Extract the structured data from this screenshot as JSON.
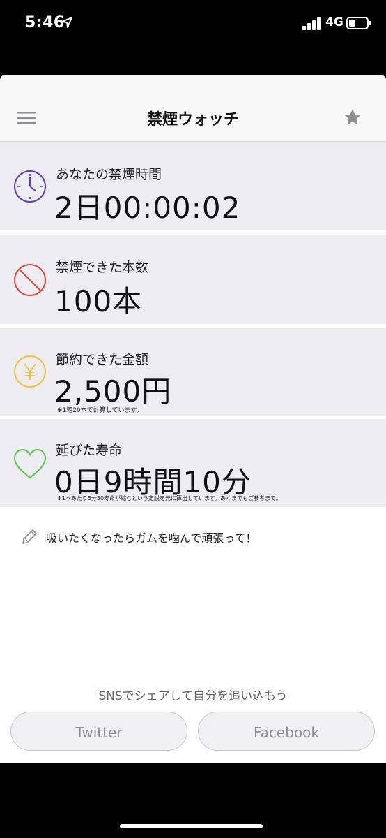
{
  "status_bar": {
    "time": "5:46",
    "network": "4G",
    "icons": [
      "location-arrow-icon",
      "signal-bars-icon",
      "battery-icon"
    ]
  },
  "nav": {
    "title": "禁煙ウォッチ",
    "left_icon": "hamburger-menu-icon",
    "right_icon": "star-icon"
  },
  "stats": [
    {
      "icon": "clock-icon",
      "label": "あなたの禁煙時間",
      "value": "2日00:00:02",
      "color": "#5b3bc4"
    },
    {
      "icon": "prohibited-icon",
      "label": "禁煙できた本数",
      "value": "100本",
      "color": "#e0453a"
    },
    {
      "icon": "yen-icon",
      "label": "節約できた金額",
      "value": "2,500円",
      "note": "※1箱20本で計算しています。",
      "color": "#f2c23a"
    },
    {
      "icon": "heart-icon",
      "label": "延びた寿命",
      "value": "0日9時間10分",
      "note": "※1本あたり5分30寿命が縮むという定説を元に算出しています。あくまでもご参考まで。",
      "color": "#5cc24b"
    }
  ],
  "hint": {
    "icon": "pencil-icon",
    "text": "吸いたくなったらガムを噛んで頑張って！"
  },
  "share": {
    "caption": "SNSでシェアして自分を追い込もう",
    "twitter_label": "Twitter",
    "facebook_label": "Facebook"
  },
  "colors": {
    "card_background": "#ececf1",
    "nav_background": "#f8f8f8",
    "button_text": "#8e8e93"
  }
}
